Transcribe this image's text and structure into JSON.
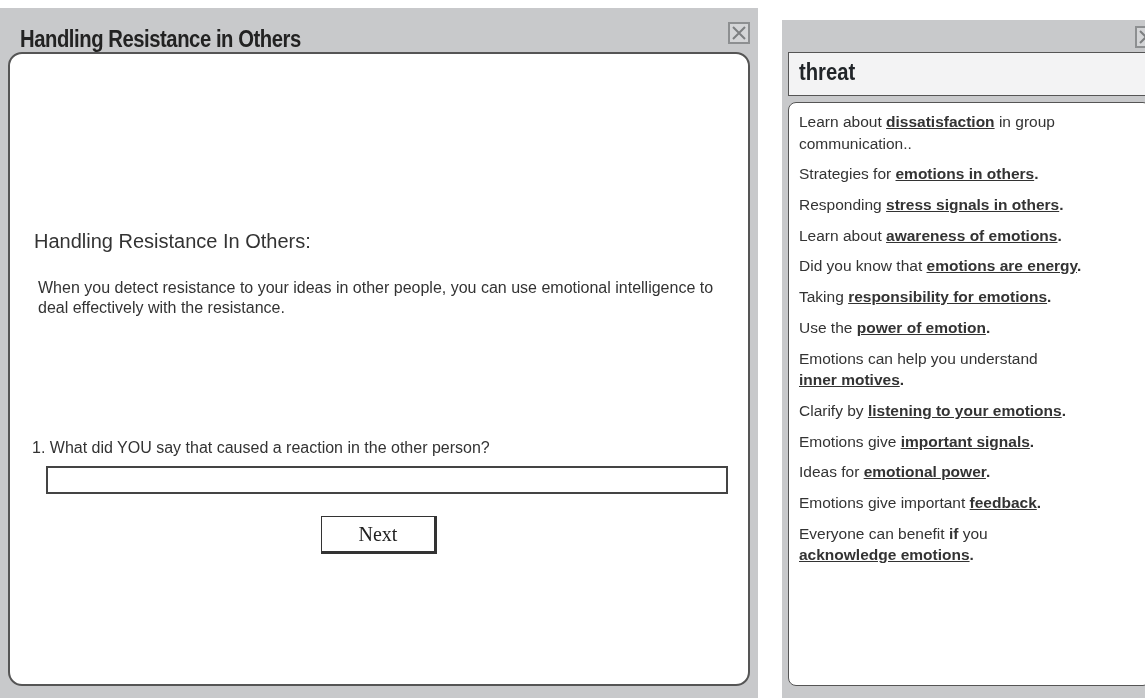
{
  "main_window": {
    "title": "Handling Resistance in Others",
    "heading": "Handling Resistance In Others:",
    "intro": "When you detect resistance to your ideas in other people, you can use emotional intelligence to deal effectively with the resistance.",
    "question": "1. What did YOU say that caused a reaction in the other person?",
    "button": "Next"
  },
  "side_window": {
    "title": "threat",
    "items": [
      {
        "before": "Learn about",
        "link": "dissatisfaction",
        "after": " in group communication.."
      },
      {
        "before": "Strategies for",
        "link": "emotions in others",
        "after": "**.**"
      },
      {
        "before": "Responding",
        "link": "stress signals in others",
        "after": "**.**"
      },
      {
        "before": "Learn about",
        "link": "awareness of emotions",
        "after": "**.**"
      },
      {
        "before": "Did you know that",
        "link": "emotions are energy",
        "after": "**.**"
      },
      {
        "before": "Taking",
        "link": "responsibility for emotions",
        "after": "**.**"
      },
      {
        "before": "Use the",
        "link": "power of emotion",
        "after": "**.**"
      },
      {
        "before": "Emotions can help you understand",
        "link": "inner motives",
        "after": "**.**"
      },
      {
        "before": "Clarify by",
        "link": "listening to your emotions",
        "after": "**.**"
      },
      {
        "before": "Emotions give",
        "link": "important signals",
        "after": "**.**"
      },
      {
        "before": "Ideas for",
        "link": "emotional power",
        "after": "**.**"
      },
      {
        "before": "Emotions give important",
        "link": "feedback",
        "after": "**.**"
      },
      {
        "before": "Everyone can benefit **if** you",
        "link": "acknowledge emotions",
        "after": "**.**"
      }
    ]
  }
}
